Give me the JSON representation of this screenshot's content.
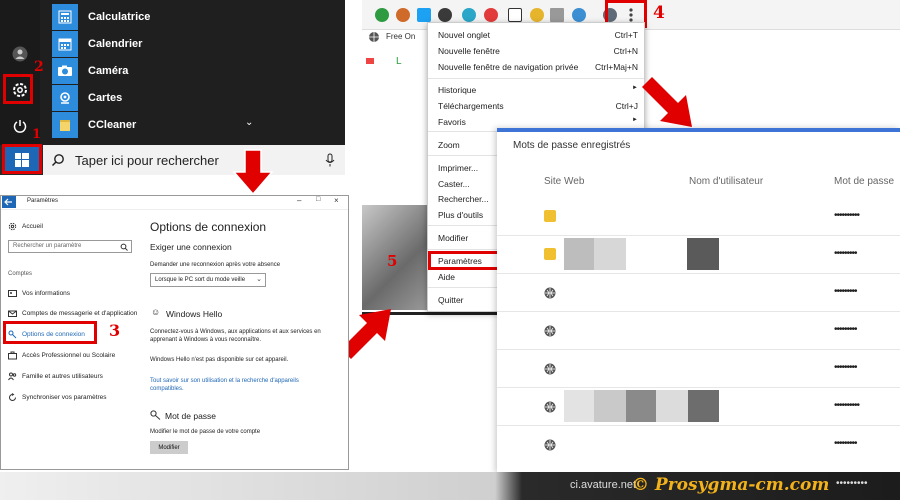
{
  "start_menu": {
    "apps": [
      {
        "label": "Calculatrice",
        "icon": "calculator-icon"
      },
      {
        "label": "Calendrier",
        "icon": "calendar-icon"
      },
      {
        "label": "Caméra",
        "icon": "camera-icon"
      },
      {
        "label": "Cartes",
        "icon": "maps-icon"
      },
      {
        "label": "CCleaner",
        "icon": "folder-icon"
      }
    ],
    "search_placeholder": "Taper ici pour rechercher",
    "step_settings": "2",
    "step_windows": "1"
  },
  "chrome": {
    "bookmark_label": "Free On",
    "tab_partial": "L",
    "step_menu": "4",
    "step_parametres": "5",
    "menu": {
      "items": [
        {
          "label": "Nouvel onglet",
          "shortcut": "Ctrl+T"
        },
        {
          "label": "Nouvelle fenêtre",
          "shortcut": "Ctrl+N"
        },
        {
          "label": "Nouvelle fenêtre de navigation privée",
          "shortcut": "Ctrl+Maj+N"
        },
        {
          "label": "Historique",
          "shortcut": "►"
        },
        {
          "label": "Téléchargements",
          "shortcut": "Ctrl+J"
        },
        {
          "label": "Favoris",
          "shortcut": "►"
        },
        {
          "label": "Zoom",
          "shortcut": ""
        },
        {
          "label": "Imprimer...",
          "shortcut": ""
        },
        {
          "label": "Caster...",
          "shortcut": ""
        },
        {
          "label": "Rechercher...",
          "shortcut": ""
        },
        {
          "label": "Plus d'outils",
          "shortcut": ""
        },
        {
          "label": "Modifier",
          "shortcut": ""
        },
        {
          "label": "Paramètres",
          "shortcut": ""
        },
        {
          "label": "Aide",
          "shortcut": "►"
        },
        {
          "label": "Quitter",
          "shortcut": ""
        }
      ]
    }
  },
  "passwords": {
    "title": "Mots de passe enregistrés",
    "col_site": "Site Web",
    "col_user": "Nom d'utilisateur",
    "col_password": "Mot de passe",
    "rows": [
      {
        "icon": "key-icon",
        "dots": "••••••••••"
      },
      {
        "icon": "key-icon",
        "dots": "•••••••••"
      },
      {
        "icon": "globe-icon",
        "dots": "•••••••••"
      },
      {
        "icon": "globe-icon",
        "dots": "•••••••••"
      },
      {
        "icon": "globe-icon",
        "dots": "•••••••••"
      },
      {
        "icon": "globe-icon",
        "dots": "••••••••••"
      },
      {
        "icon": "globe-icon",
        "dots": "•••••••••"
      }
    ]
  },
  "settings": {
    "window_title": "Paramètres",
    "nav_home": "Accueil",
    "search_placeholder": "Rechercher un paramètre",
    "section_label": "Comptes",
    "nav": [
      "Vos informations",
      "Comptes de messagerie et d'application",
      "Options de connexion",
      "Accès Professionnel ou Scolaire",
      "Famille et autres utilisateurs",
      "Synchroniser vos paramètres"
    ],
    "step_options": "3",
    "heading": "Options de connexion",
    "require_title": "Exiger une connexion",
    "require_desc": "Demander une reconnexion après votre absence",
    "require_value": "Lorsque le PC sort du mode veille",
    "hello_title": "Windows Hello",
    "hello_desc": "Connectez-vous à Windows, aux applications et aux services en apprenant à Windows à vous reconnaître.",
    "hello_unavailable": "Windows Hello n'est pas disponible sur cet appareil.",
    "hello_link": "Tout savoir sur son utilisation et la recherche d'appareils compatibles.",
    "pw_title": "Mot de passe",
    "pw_desc": "Modifier le mot de passe de votre compte",
    "pw_button": "Modifier"
  },
  "footer": {
    "domain": "ci.avature.net",
    "brand": "© Prosygma-cm.com",
    "dots": "•••••••••"
  },
  "colors": {
    "accent_red": "#e00000",
    "windows_blue": "#1e67b6",
    "brand_gold": "#f3b21a"
  }
}
